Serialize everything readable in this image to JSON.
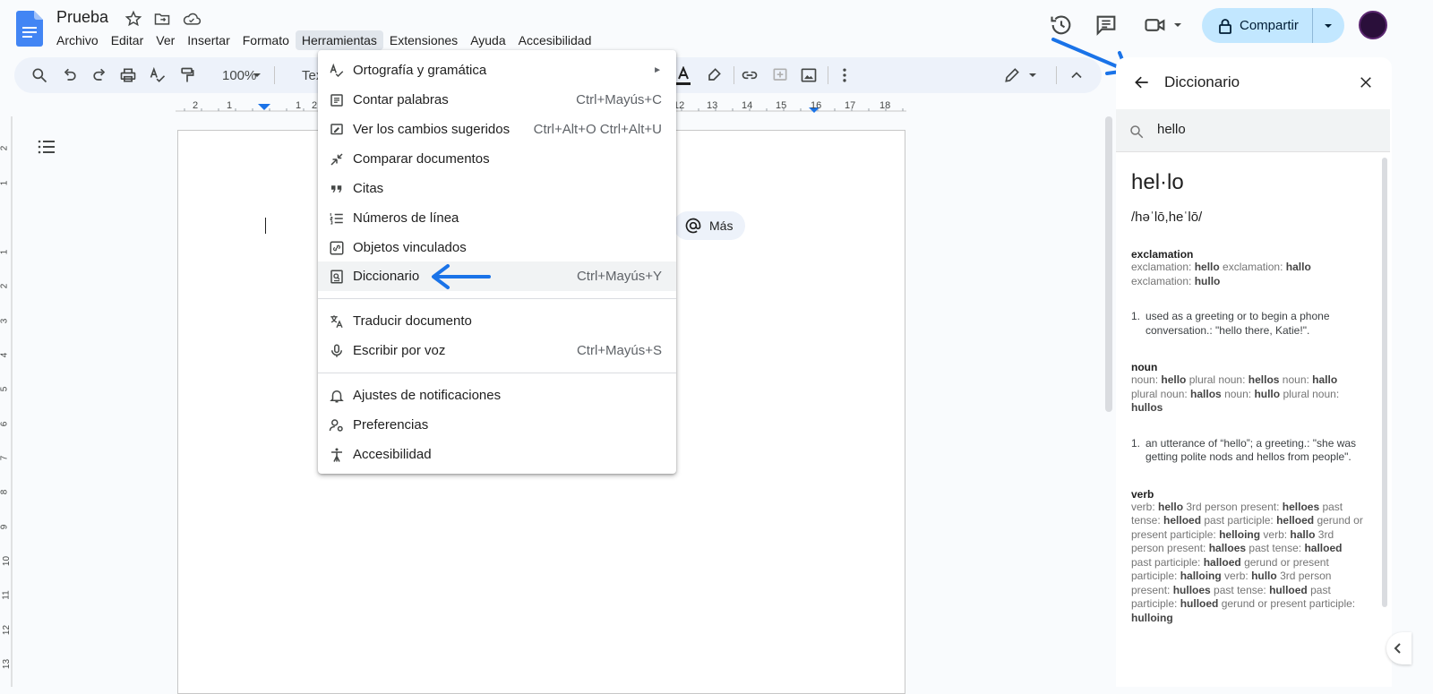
{
  "document": {
    "title": "Prueba"
  },
  "menubar": [
    "Archivo",
    "Editar",
    "Ver",
    "Insertar",
    "Formato",
    "Herramientas",
    "Extensiones",
    "Ayuda",
    "Accesibilidad"
  ],
  "share": {
    "label": "Compartir"
  },
  "toolbar": {
    "zoom": "100%",
    "style_partial": "Texto"
  },
  "ruler": [
    "2",
    "1",
    "1",
    "2",
    "12",
    "13",
    "14",
    "15",
    "16",
    "17",
    "18"
  ],
  "vruler": [
    "2",
    "1",
    "1",
    "2",
    "3",
    "4",
    "5",
    "6",
    "7",
    "8",
    "9",
    "10",
    "11",
    "12",
    "13"
  ],
  "smart_chip": {
    "label": "Más"
  },
  "tools_menu": {
    "items": [
      {
        "label": "Ortografía y gramática",
        "shortcut": "",
        "submenu": "►"
      },
      {
        "label": "Contar palabras",
        "shortcut": "Ctrl+Mayús+C"
      },
      {
        "label": "Ver los cambios sugeridos",
        "shortcut": "Ctrl+Alt+O Ctrl+Alt+U"
      },
      {
        "label": "Comparar documentos",
        "shortcut": ""
      },
      {
        "label": "Citas",
        "shortcut": ""
      },
      {
        "label": "Números de línea",
        "shortcut": ""
      },
      {
        "label": "Objetos vinculados",
        "shortcut": ""
      },
      {
        "label": "Diccionario",
        "shortcut": "Ctrl+Mayús+Y"
      },
      {
        "label": "Traducir documento",
        "shortcut": ""
      },
      {
        "label": "Escribir por voz",
        "shortcut": "Ctrl+Mayús+S"
      },
      {
        "label": "Ajustes de notificaciones",
        "shortcut": ""
      },
      {
        "label": "Preferencias",
        "shortcut": ""
      },
      {
        "label": "Accesibilidad",
        "shortcut": ""
      }
    ]
  },
  "dictionary": {
    "title": "Diccionario",
    "search_value": "hello",
    "word": "hel·lo",
    "pronunciation": "/həˈlō,heˈlō/",
    "exclamation": {
      "pos": "exclamation",
      "t1": "exclamation: ",
      "w1": "hello",
      "t2": " exclamation: ",
      "w2": "hallo",
      "t3": " exclamation: ",
      "w3": "hullo",
      "def_num": "1.",
      "def": "used as a greeting or to begin a phone conversation.: \"hello there, Katie!\"."
    },
    "noun": {
      "pos": "noun",
      "t1": "noun: ",
      "w1": "hello",
      "t2": " plural noun: ",
      "w2": "hellos",
      "t3": " noun: ",
      "w3": "hallo",
      "t4": " plural noun: ",
      "w4": "hallos",
      "t5": " noun: ",
      "w5": "hullo",
      "t6": " plural noun: ",
      "w6": "hullos",
      "def_num": "1.",
      "def": "an utterance of “hello”; a greeting.: \"she was getting polite nods and hellos from people\"."
    },
    "verb": {
      "pos": "verb",
      "t1": "verb: ",
      "w1": "hello",
      "t2": " 3rd person present: ",
      "w2": "helloes",
      "t3": " past tense: ",
      "w3": "helloed",
      "t4": " past participle: ",
      "w4": "helloed",
      "t5": " gerund or present participle: ",
      "w5": "helloing",
      "t6": " verb: ",
      "w6": "hallo",
      "t7": " 3rd person present: ",
      "w7": "halloes",
      "t8": " past tense: ",
      "w8": "halloed",
      "t9": " past participle: ",
      "w9": "halloed",
      "t10": " gerund or present participle: ",
      "w10": "halloing",
      "t11": " verb: ",
      "w11": "hullo",
      "t12": " 3rd person present: ",
      "w12": "hulloes",
      "t13": " past tense: ",
      "w13": "hulloed",
      "t14": " past participle: ",
      "w14": "hulloed",
      "t15": " gerund or present participle: ",
      "w15": "hulloing"
    }
  },
  "colors": {
    "accent": "#0b57d0",
    "share_bg": "#c2e7ff",
    "annotation_arrow": "#1a73e8"
  }
}
